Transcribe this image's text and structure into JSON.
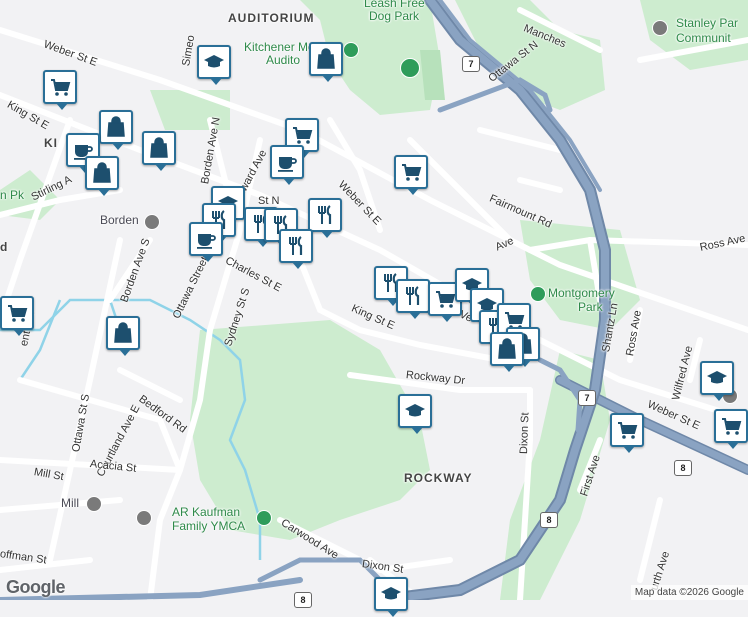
{
  "labels": {
    "auditorium": "AUDITORIUM",
    "dog_park_1": "Leash Free",
    "dog_park_2": "Dog Park",
    "kitchener_memorial_1": "Kitchener Mem",
    "kitchener_memorial_2": "Audito",
    "stanley_park_1": "Stanley Par",
    "stanley_park_2": "Communit",
    "montgomery_1": "Montgomery",
    "montgomery_2": "Park",
    "rockway": "ROCKWAY",
    "ymca_1": "AR Kaufman",
    "ymca_2": "Family YMCA",
    "borden": "Borden",
    "mill": "Mill",
    "pk": "n Pk",
    "ki": "KI",
    "d_edge": "d"
  },
  "roads": {
    "weber_nw": "Weber St E",
    "weber_mid": "Weber St E",
    "weber_east": "Weber St E",
    "king_nw": "King St E",
    "king_mid": "King St E",
    "king_east": "Ve",
    "ottawa_n": "Ottawa St N",
    "ottawa_s": "Ottawa Street S",
    "ottawa_st_s": "Ottawa St S",
    "charles": "Charles St E",
    "stirling": "Stirling A",
    "borden_n": "Borden Ave N",
    "borden_s": "Borden Ave S",
    "simeon": "Simeo",
    "onward": "nward Ave",
    "st_n": "St N",
    "sydney": "Sydney St S",
    "bedford": "Bedford Rd",
    "courtland": "Courtland Ave E",
    "acacia": "Acacia St",
    "mill_st": "Mill St",
    "hoffman": "offman St",
    "rockway_dr": "Rockway Dr",
    "dixon_st": "Dixon St",
    "dixon_st_2": "Dixon St",
    "carwood": "Carwood Ave",
    "fairmount": "Fairmount Rd",
    "ave_frag": "Ave",
    "ross": "Ross Ave",
    "shantz": "Shantz Ln",
    "ross_v": "Ross Ave",
    "wilfred": "Wilfred Ave",
    "first": "First Ave",
    "fourth": "urth Ave",
    "manches": "Manches",
    "stent": "ent Ave"
  },
  "shields": {
    "hwy7_a": "7",
    "hwy7_b": "7",
    "hwy8_a": "8",
    "hwy8_b": "8",
    "hwy8_c": "8"
  },
  "branding": {
    "google": "Google",
    "attribution": "Map data ©2026 Google"
  },
  "colors": {
    "background": "#f2f2f4",
    "park": "#cdeccf",
    "water": "#8fd3e8",
    "highway": "#8aa3c2",
    "highway_casing": "#6f88a8",
    "road": "#ffffff",
    "poi_border": "#2a6f97",
    "poi_icon": "#1d4f6e"
  },
  "markers": [
    {
      "id": "education-1",
      "icon": "education-icon"
    },
    {
      "id": "shopping-1",
      "icon": "shopping-bag-icon"
    },
    {
      "id": "grocery-1",
      "icon": "grocery-cart-icon"
    },
    {
      "id": "shopping-2",
      "icon": "shopping-bag-icon"
    },
    {
      "id": "cafe-1",
      "icon": "coffee-cup-icon"
    },
    {
      "id": "shopping-3",
      "icon": "shopping-bag-icon"
    },
    {
      "id": "shopping-4",
      "icon": "shopping-bag-icon"
    },
    {
      "id": "grocery-2",
      "icon": "grocery-cart-icon"
    },
    {
      "id": "cafe-2",
      "icon": "coffee-cup-icon"
    },
    {
      "id": "grocery-3",
      "icon": "grocery-cart-icon"
    },
    {
      "id": "education-2",
      "icon": "education-icon"
    },
    {
      "id": "restaurant-1",
      "icon": "restaurant-icon"
    },
    {
      "id": "restaurant-2",
      "icon": "restaurant-icon"
    },
    {
      "id": "cafe-3",
      "icon": "coffee-cup-icon"
    },
    {
      "id": "restaurant-3",
      "icon": "restaurant-icon"
    },
    {
      "id": "cafe-4",
      "icon": "coffee-cup-icon"
    },
    {
      "id": "restaurant-4",
      "icon": "restaurant-icon"
    },
    {
      "id": "grocery-4",
      "icon": "grocery-cart-icon"
    },
    {
      "id": "shopping-5",
      "icon": "shopping-bag-icon"
    },
    {
      "id": "restaurant-5",
      "icon": "restaurant-icon"
    },
    {
      "id": "restaurant-6",
      "icon": "restaurant-icon"
    },
    {
      "id": "grocery-5",
      "icon": "grocery-cart-icon"
    },
    {
      "id": "education-3",
      "icon": "education-icon"
    },
    {
      "id": "education-4",
      "icon": "education-icon"
    },
    {
      "id": "restaurant-7",
      "icon": "restaurant-icon"
    },
    {
      "id": "grocery-6",
      "icon": "grocery-cart-icon"
    },
    {
      "id": "shopping-6",
      "icon": "shopping-bag-icon"
    },
    {
      "id": "shopping-7",
      "icon": "shopping-bag-icon"
    },
    {
      "id": "education-5",
      "icon": "education-icon"
    },
    {
      "id": "education-6",
      "icon": "education-icon"
    },
    {
      "id": "grocery-7",
      "icon": "grocery-cart-icon"
    },
    {
      "id": "grocery-8",
      "icon": "grocery-cart-icon"
    },
    {
      "id": "education-7",
      "icon": "education-icon"
    }
  ]
}
